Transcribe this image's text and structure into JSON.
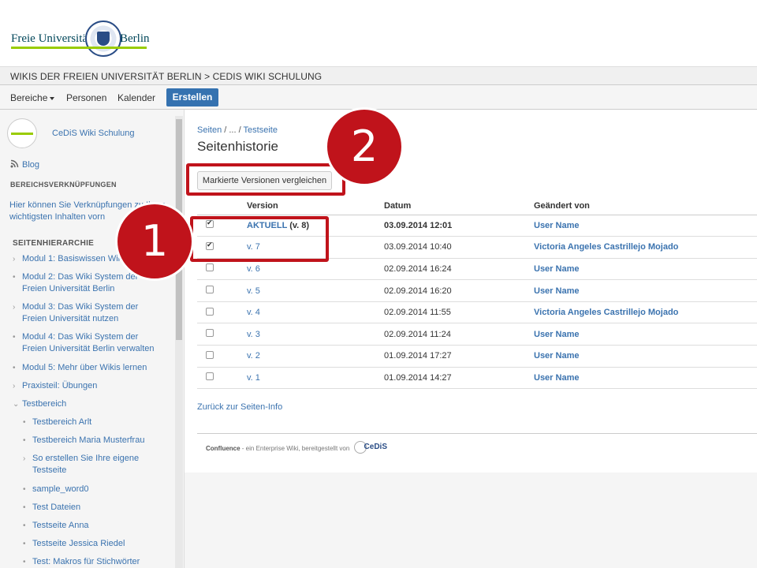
{
  "logo": {
    "text_left": "Freie Universität",
    "text_right": "Berlin"
  },
  "breadcrumb_band": "WIKIS DER FREIEN UNIVERSITÄT BERLIN > CEDIS WIKI SCHULUNG",
  "nav": {
    "items": [
      "Bereiche",
      "Personen",
      "Kalender"
    ],
    "create_label": "Erstellen"
  },
  "sidebar": {
    "space_name": "CeDiS Wiki Schulung",
    "blog_label": "Blog",
    "links_heading": "BEREICHSVERKNÜPFUNGEN",
    "links_desc": "Hier können Sie Verknüpfungen zu Ihren wichtigsten Inhalten vorn",
    "tree_heading": "SEITENHIERARCHIE",
    "tree": [
      "Modul 1: Basiswissen Wiki",
      "Modul 2: Das Wiki System der Freien Universität Berlin",
      "Modul 3: Das Wiki System der Freien Universität nutzen",
      "Modul 4: Das Wiki System der Freien Universität Berlin verwalten",
      "Modul 5: Mehr über Wikis lernen",
      "Praxisteil: Übungen",
      "Testbereich",
      "Testbereich Arlt",
      "Testbereich Maria Musterfrau",
      "So erstellen Sie Ihre eigene Testseite",
      "sample_word0",
      "Test Dateien",
      "Testseite Anna",
      "Testseite Jessica Riedel",
      "Test: Makros für Stichwörter"
    ]
  },
  "main": {
    "crumbs": {
      "first": "Seiten",
      "ellipsis": "/ ... /",
      "last": "Testseite"
    },
    "title": "Seitenhistorie",
    "compare_button": "Markierte Versionen vergleichen",
    "columns": [
      "Version",
      "Datum",
      "Geändert von"
    ],
    "rows": [
      {
        "checked": true,
        "version": "AKTUELL",
        "version_suffix": " (v. 8)",
        "date": "03.09.2014 12:01",
        "user": "User Name",
        "current": true
      },
      {
        "checked": true,
        "version": "v. 7",
        "version_suffix": "",
        "date": "03.09.2014 10:40",
        "user": "Victoria Angeles Castrillejo Mojado",
        "current": false
      },
      {
        "checked": false,
        "version": "v. 6",
        "version_suffix": "",
        "date": "02.09.2014 16:24",
        "user": "User Name",
        "current": false
      },
      {
        "checked": false,
        "version": "v. 5",
        "version_suffix": "",
        "date": "02.09.2014 16:20",
        "user": "User Name",
        "current": false
      },
      {
        "checked": false,
        "version": "v. 4",
        "version_suffix": "",
        "date": "02.09.2014 11:55",
        "user": "Victoria Angeles Castrillejo Mojado",
        "current": false
      },
      {
        "checked": false,
        "version": "v. 3",
        "version_suffix": "",
        "date": "02.09.2014 11:24",
        "user": "User Name",
        "current": false
      },
      {
        "checked": false,
        "version": "v. 2",
        "version_suffix": "",
        "date": "01.09.2014 17:27",
        "user": "User Name",
        "current": false
      },
      {
        "checked": false,
        "version": "v. 1",
        "version_suffix": "",
        "date": "01.09.2014 14:27",
        "user": "User Name",
        "current": false
      }
    ],
    "back_link": "Zurück zur Seiten-Info",
    "footer": {
      "brand": "Confluence",
      "text": " - ein Enterprise Wiki, bereitgestellt von",
      "logo_text": "CeDiS"
    }
  },
  "annotations": {
    "one": "1",
    "two": "2"
  },
  "colors": {
    "accent": "#3572b0",
    "link": "#3b73af",
    "annotation": "#c0131b",
    "fu_green": "#99cc00"
  }
}
